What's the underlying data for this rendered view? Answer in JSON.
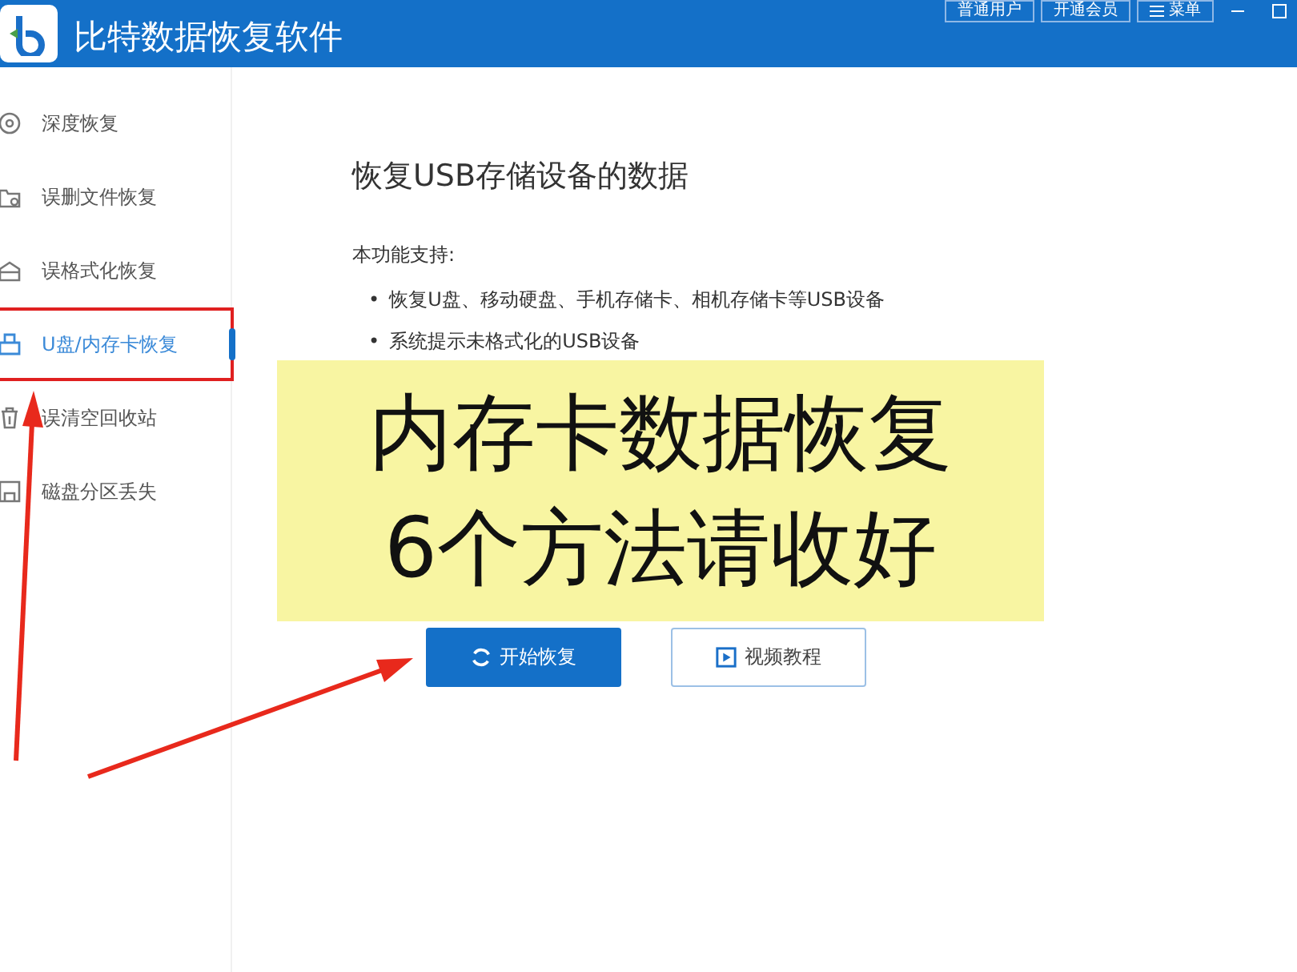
{
  "window": {
    "title": "比特数据恢复软件",
    "header_buttons": [
      "普通用户",
      "开通会员",
      "菜单"
    ]
  },
  "sidebar": {
    "items": [
      {
        "label": "深度恢复",
        "selected": false
      },
      {
        "label": "误删文件恢复",
        "selected": false
      },
      {
        "label": "误格式化恢复",
        "selected": false
      },
      {
        "label": "U盘/内存卡恢复",
        "selected": true
      },
      {
        "label": "误清空回收站",
        "selected": false
      },
      {
        "label": "磁盘分区丢失",
        "selected": false
      }
    ]
  },
  "main": {
    "heading": "恢复USB存储设备的数据",
    "intro": "本功能支持:",
    "bullet_marker": "•",
    "bullets": [
      "恢复U盘、移动硬盘、手机存储卡、相机存储卡等USB设备",
      "系统提示未格式化的USB设备"
    ],
    "buttons": [
      {
        "label": "开始恢复",
        "kind": "primary"
      },
      {
        "label": "视频教程",
        "kind": "secondary"
      }
    ]
  },
  "overlay": {
    "lines": [
      "内存卡数据恢复",
      "6个方法请收好"
    ]
  }
}
